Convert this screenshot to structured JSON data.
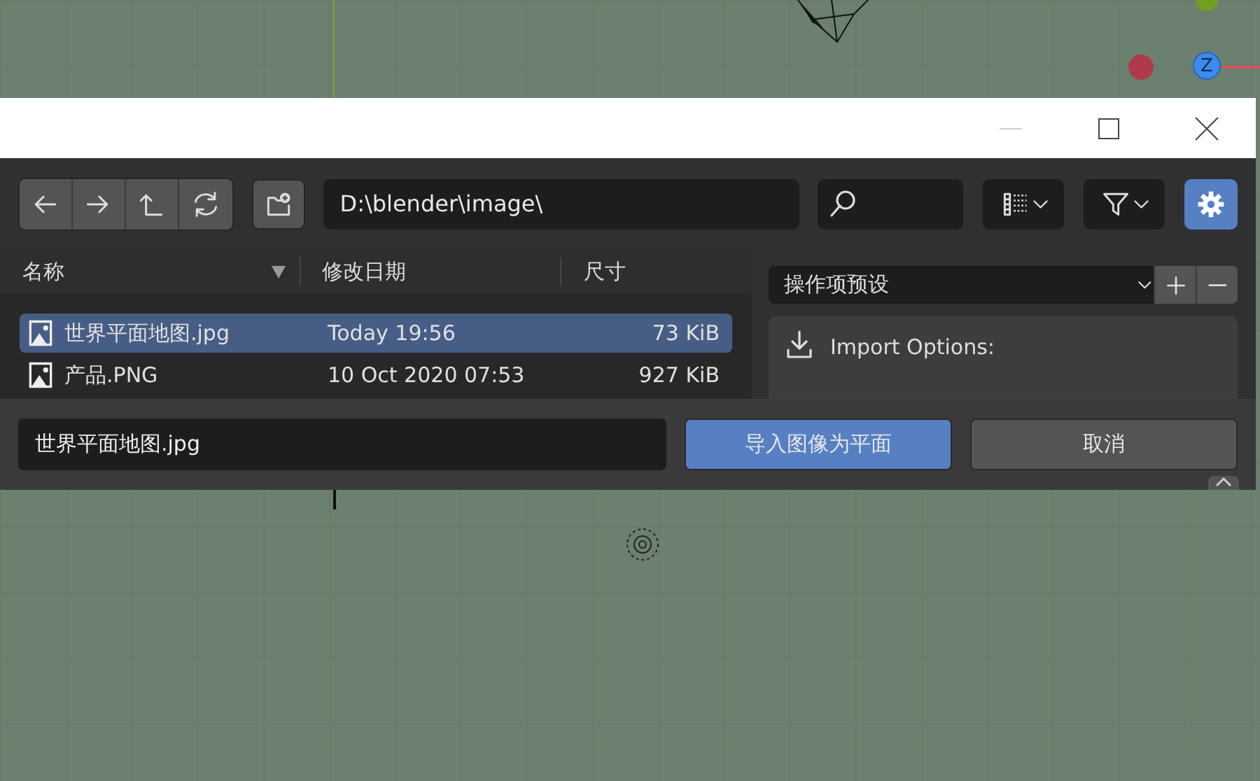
{
  "gizmo": {
    "axis_label": "Z"
  },
  "dialog": {
    "path": "D:\\blender\\image\\",
    "settings_on": true,
    "columns": [
      {
        "label": "名称",
        "sorted": true
      },
      {
        "label": "修改日期",
        "sorted": false
      },
      {
        "label": "尺寸",
        "sorted": false
      }
    ],
    "files": [
      {
        "name": "世界平面地图.jpg",
        "date": "Today 19:56",
        "size": "73 KiB",
        "selected": true
      },
      {
        "name": "产品.PNG",
        "date": "10 Oct 2020 07:53",
        "size": "927 KiB",
        "selected": false
      }
    ],
    "preset": "操作项预设",
    "panel_title": "Import Options:",
    "filename": "世界平面地图.jpg",
    "buttons": [
      {
        "label": "导入图像为平面",
        "kind": "primary"
      },
      {
        "label": "取消",
        "kind": "secondary"
      }
    ]
  }
}
